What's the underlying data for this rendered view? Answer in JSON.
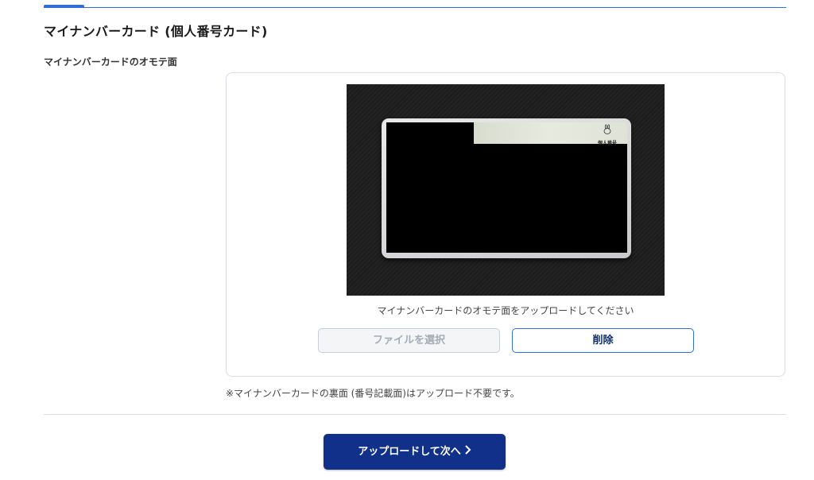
{
  "section": {
    "title": "マイナンバーカード (個人番号カード)",
    "field_label": "マイナンバーカードのオモテ面"
  },
  "upload": {
    "caption": "マイナンバーカードのオモテ面をアップロードしてください",
    "select_file_label": "ファイルを選択",
    "delete_label": "削除",
    "card_logo_text": "個人番号"
  },
  "note": "※マイナンバーカードの裏面 (番号記載面)はアップロード不要です。",
  "footer": {
    "next_label": "アップロードして次へ",
    "next_icon": "chevron-right-icon"
  },
  "colors": {
    "accent": "#2f6fd6",
    "primary_button": "#10308a",
    "disabled_text": "#a4abb6"
  }
}
